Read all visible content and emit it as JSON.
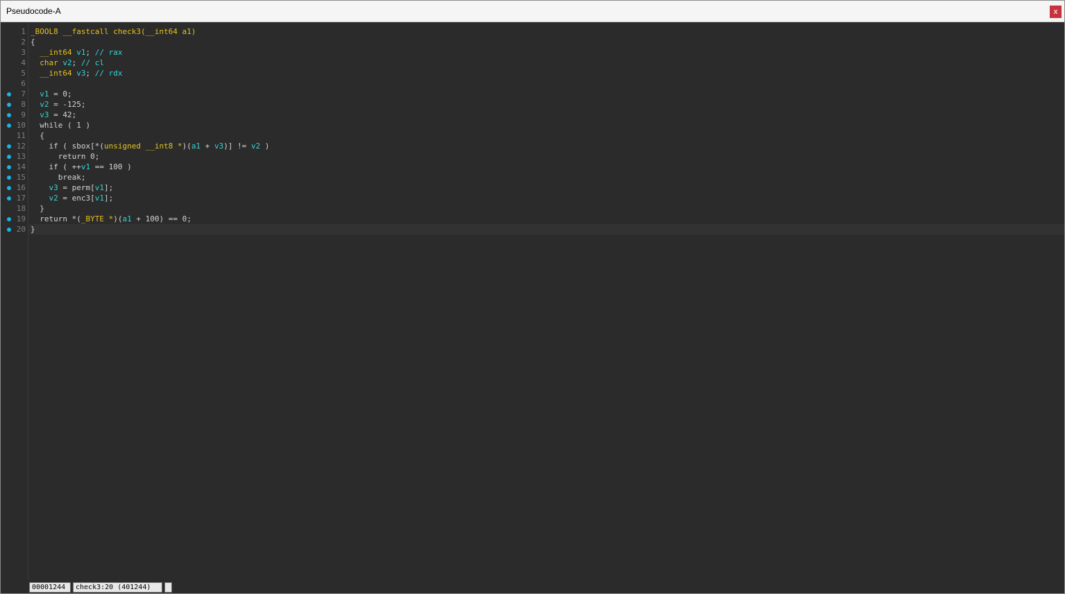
{
  "window": {
    "title": "Pseudocode-A",
    "close_label": "x"
  },
  "lines": [
    {
      "num": "1",
      "bp": false,
      "tokens": [
        [
          "_BOOL8 __fastcall check3(__int64 a1)",
          "y"
        ]
      ]
    },
    {
      "num": "2",
      "bp": false,
      "tokens": [
        [
          "{",
          "w"
        ]
      ]
    },
    {
      "num": "3",
      "bp": false,
      "tokens": [
        [
          "  ",
          "w"
        ],
        [
          "__int64 ",
          "y"
        ],
        [
          "v1",
          "c"
        ],
        [
          "; ",
          "w"
        ],
        [
          "// rax",
          "c"
        ]
      ]
    },
    {
      "num": "4",
      "bp": false,
      "tokens": [
        [
          "  ",
          "w"
        ],
        [
          "char ",
          "y"
        ],
        [
          "v2",
          "c"
        ],
        [
          "; ",
          "w"
        ],
        [
          "// cl",
          "c"
        ]
      ]
    },
    {
      "num": "5",
      "bp": false,
      "tokens": [
        [
          "  ",
          "w"
        ],
        [
          "__int64 ",
          "y"
        ],
        [
          "v3",
          "c"
        ],
        [
          "; ",
          "w"
        ],
        [
          "// rdx",
          "c"
        ]
      ]
    },
    {
      "num": "6",
      "bp": false,
      "tokens": [
        [
          "",
          "w"
        ]
      ]
    },
    {
      "num": "7",
      "bp": true,
      "tokens": [
        [
          "  ",
          "w"
        ],
        [
          "v1",
          "c"
        ],
        [
          " = 0;",
          "w"
        ]
      ]
    },
    {
      "num": "8",
      "bp": true,
      "tokens": [
        [
          "  ",
          "w"
        ],
        [
          "v2",
          "c"
        ],
        [
          " = -125;",
          "w"
        ]
      ]
    },
    {
      "num": "9",
      "bp": true,
      "tokens": [
        [
          "  ",
          "w"
        ],
        [
          "v3",
          "c"
        ],
        [
          " = 42;",
          "w"
        ]
      ]
    },
    {
      "num": "10",
      "bp": true,
      "tokens": [
        [
          "  while ( 1 )",
          "w"
        ]
      ]
    },
    {
      "num": "11",
      "bp": false,
      "tokens": [
        [
          "  {",
          "w"
        ]
      ]
    },
    {
      "num": "12",
      "bp": true,
      "tokens": [
        [
          "    if ( sbox[*(",
          "w"
        ],
        [
          "unsigned __int8 *",
          "y"
        ],
        [
          ")(",
          "w"
        ],
        [
          "a1",
          "c"
        ],
        [
          " + ",
          "w"
        ],
        [
          "v3",
          "c"
        ],
        [
          ")] != ",
          "w"
        ],
        [
          "v2",
          "c"
        ],
        [
          " )",
          "w"
        ]
      ]
    },
    {
      "num": "13",
      "bp": true,
      "tokens": [
        [
          "      return 0;",
          "w"
        ]
      ]
    },
    {
      "num": "14",
      "bp": true,
      "tokens": [
        [
          "    if ( ++",
          "w"
        ],
        [
          "v1",
          "c"
        ],
        [
          " == 100 )",
          "w"
        ]
      ]
    },
    {
      "num": "15",
      "bp": true,
      "tokens": [
        [
          "      break;",
          "w"
        ]
      ]
    },
    {
      "num": "16",
      "bp": true,
      "tokens": [
        [
          "    ",
          "w"
        ],
        [
          "v3",
          "c"
        ],
        [
          " = perm[",
          "w"
        ],
        [
          "v1",
          "c"
        ],
        [
          "];",
          "w"
        ]
      ]
    },
    {
      "num": "17",
      "bp": true,
      "tokens": [
        [
          "    ",
          "w"
        ],
        [
          "v2",
          "c"
        ],
        [
          " = enc3[",
          "w"
        ],
        [
          "v1",
          "c"
        ],
        [
          "];",
          "w"
        ]
      ]
    },
    {
      "num": "18",
      "bp": false,
      "tokens": [
        [
          "  }",
          "w"
        ]
      ]
    },
    {
      "num": "19",
      "bp": true,
      "tokens": [
        [
          "  return *(",
          "w"
        ],
        [
          "_BYTE *",
          "y"
        ],
        [
          ")(",
          "w"
        ],
        [
          "a1",
          "c"
        ],
        [
          " + 100) == 0;",
          "w"
        ]
      ]
    },
    {
      "num": "20",
      "bp": true,
      "current": true,
      "tokens": [
        [
          "}",
          "w"
        ]
      ]
    }
  ],
  "status": {
    "address": "00001244",
    "location": "check3:20 (401244)",
    "extra": ""
  },
  "colors": {
    "keyword_type": "#e5c21e",
    "variable": "#34d6d6",
    "text": "#d4d4d4",
    "breakpoint_dot": "#1ab3e6",
    "background": "#2b2b2b"
  }
}
